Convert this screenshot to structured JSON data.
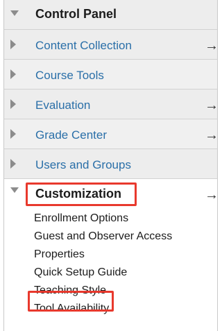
{
  "control_panel": {
    "title": "Control Panel",
    "items": [
      {
        "label": "Content Collection",
        "has_arrow": true
      },
      {
        "label": "Course Tools",
        "has_arrow": false
      },
      {
        "label": "Evaluation",
        "has_arrow": true
      },
      {
        "label": "Grade Center",
        "has_arrow": true
      },
      {
        "label": "Users and Groups",
        "has_arrow": false
      }
    ],
    "expanded_section": {
      "title": "Customization",
      "arrow": "→",
      "links": [
        "Enrollment Options",
        "Guest and Observer Access",
        "Properties",
        "Quick Setup Guide",
        "Teaching Style",
        "Tool Availability"
      ]
    },
    "arrow_glyph": "→"
  },
  "colors": {
    "link": "#2a6fa8",
    "highlight": "#e8392d",
    "row_bg": "#ededed"
  }
}
